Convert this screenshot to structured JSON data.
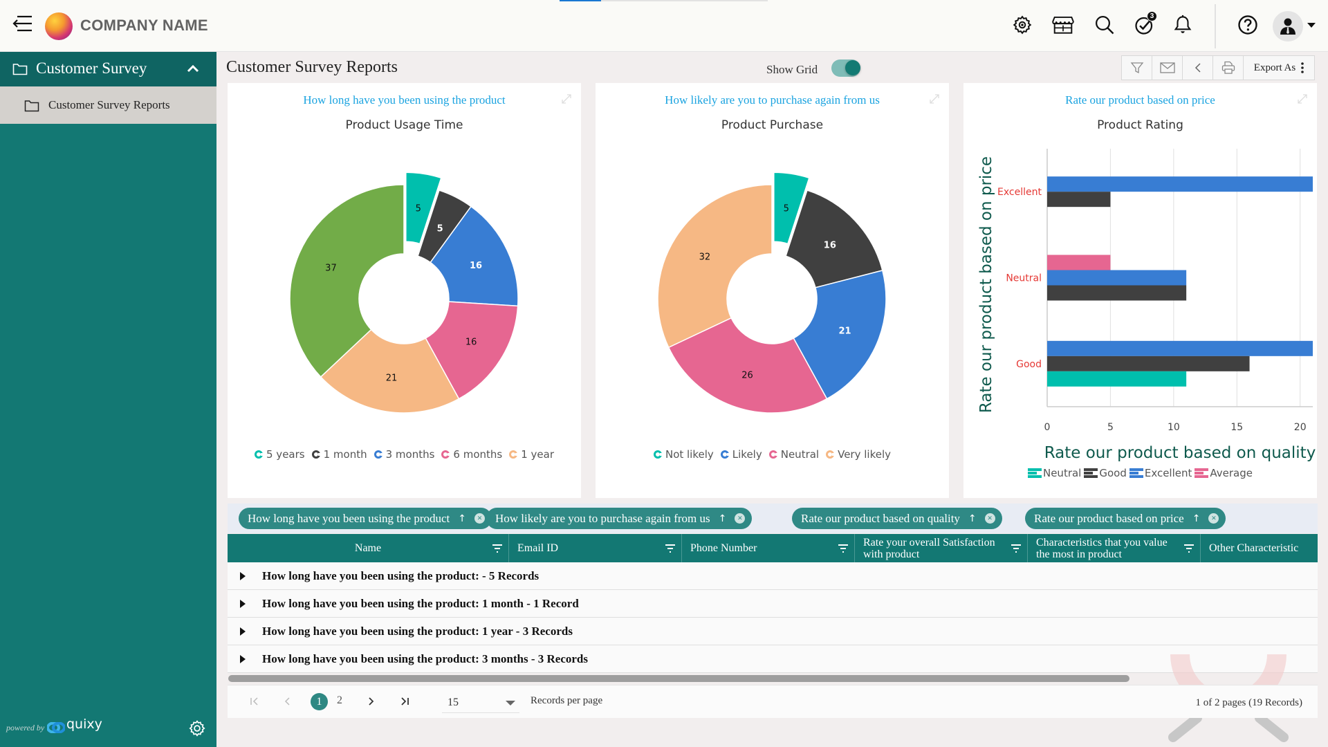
{
  "header": {
    "company_name": "COMPANY NAME",
    "loading_progress_percent": 20,
    "notifications_badge": "3",
    "icons": [
      "menu-collapse-icon",
      "settings-icon",
      "store-icon",
      "search-icon",
      "tasks-check-icon",
      "bell-icon",
      "help-icon",
      "user-avatar-icon"
    ]
  },
  "sidebar": {
    "section_label": "Customer Survey",
    "items": [
      {
        "label": "Customer Survey Reports"
      }
    ],
    "powered_by": "powered by",
    "brand": "quixy"
  },
  "page": {
    "title": "Customer Survey Reports",
    "show_grid_label": "Show Grid",
    "show_grid_on": true,
    "toolbar": {
      "export_label": "Export As"
    }
  },
  "chart_data": [
    {
      "type": "pie",
      "variant": "donut",
      "question": "How long have you been using the product",
      "title": "Product Usage Time",
      "slices": [
        {
          "label": "5 years",
          "value": 5,
          "color": "#00bfad",
          "exploded": true
        },
        {
          "label": "1 month",
          "value": 5,
          "color": "#404040"
        },
        {
          "label": "3 months",
          "value": 16,
          "color": "#387dd3"
        },
        {
          "label": "6 months",
          "value": 16,
          "color": "#e66691"
        },
        {
          "label": "1 year",
          "value": 21,
          "color": "#f6b884"
        },
        {
          "label": "",
          "value": 37,
          "color": "#72ac48"
        }
      ],
      "legend": [
        "5 years",
        "1 month",
        "3 months",
        "6 months",
        "1 year"
      ],
      "legend_position": "bottom"
    },
    {
      "type": "pie",
      "variant": "donut",
      "question": "How likely are you to purchase again from us",
      "title": "Product Purchase",
      "slices": [
        {
          "label": "Not likely",
          "value": 5,
          "color": "#00bfad",
          "exploded": true
        },
        {
          "label": "",
          "value": 16,
          "color": "#404040"
        },
        {
          "label": "Likely",
          "value": 21,
          "color": "#387dd3"
        },
        {
          "label": "Neutral",
          "value": 26,
          "color": "#e66691"
        },
        {
          "label": "Very likely",
          "value": 32,
          "color": "#f6b884"
        }
      ],
      "legend": [
        "Not likely",
        "Likely",
        "Neutral",
        "Very likely"
      ],
      "legend_position": "bottom"
    },
    {
      "type": "bar",
      "orientation": "horizontal",
      "question": "Rate our product based on price",
      "title": "Product Rating",
      "ylabel": "Rate our product based on price",
      "xlabel": "Rate our product based on quality",
      "categories": [
        "Excellent",
        "Neutral",
        "Good"
      ],
      "xlim": [
        0,
        21
      ],
      "xticks": [
        0,
        5,
        10,
        15,
        20
      ],
      "grid": true,
      "series": [
        {
          "name": "Average",
          "color": "#e66691",
          "values": [
            0,
            5,
            0
          ]
        },
        {
          "name": "Excellent",
          "color": "#387dd3",
          "values": [
            21,
            11,
            21
          ]
        },
        {
          "name": "Good",
          "color": "#404040",
          "values": [
            5,
            11,
            16
          ]
        },
        {
          "name": "Neutral",
          "color": "#00bfad",
          "values": [
            0,
            0,
            11
          ]
        }
      ],
      "legend": [
        "Neutral",
        "Good",
        "Excellent",
        "Average"
      ],
      "legend_position": "bottom"
    }
  ],
  "grouping": {
    "chips": [
      {
        "label": "How long have you been using the product"
      },
      {
        "label": "How likely are you to purchase again from us"
      },
      {
        "label": "Rate our product based on quality"
      },
      {
        "label": "Rate our product based on price"
      }
    ],
    "sort_symbol": "↑",
    "remove_symbol": "✕"
  },
  "table": {
    "columns": [
      {
        "label": "Name"
      },
      {
        "label": "Email ID"
      },
      {
        "label": "Phone Number"
      },
      {
        "label": "Rate your overall Satisfaction with product"
      },
      {
        "label": "Characteristics that you value the most in product"
      },
      {
        "label": "Other Characteristic"
      }
    ],
    "groups": [
      {
        "text": "How long have you been using the product: - 5 Records"
      },
      {
        "text": "How long have you been using the product: 1 month - 1 Record"
      },
      {
        "text": "How long have you been using the product: 1 year - 3 Records"
      },
      {
        "text": "How long have you been using the product: 3 months - 3 Records"
      }
    ]
  },
  "pagination": {
    "pages": [
      "1",
      "2"
    ],
    "current_page": "1",
    "records_per_page": "15",
    "records_per_page_label": "Records per page",
    "summary": "1 of 2 pages (19 Records)"
  }
}
